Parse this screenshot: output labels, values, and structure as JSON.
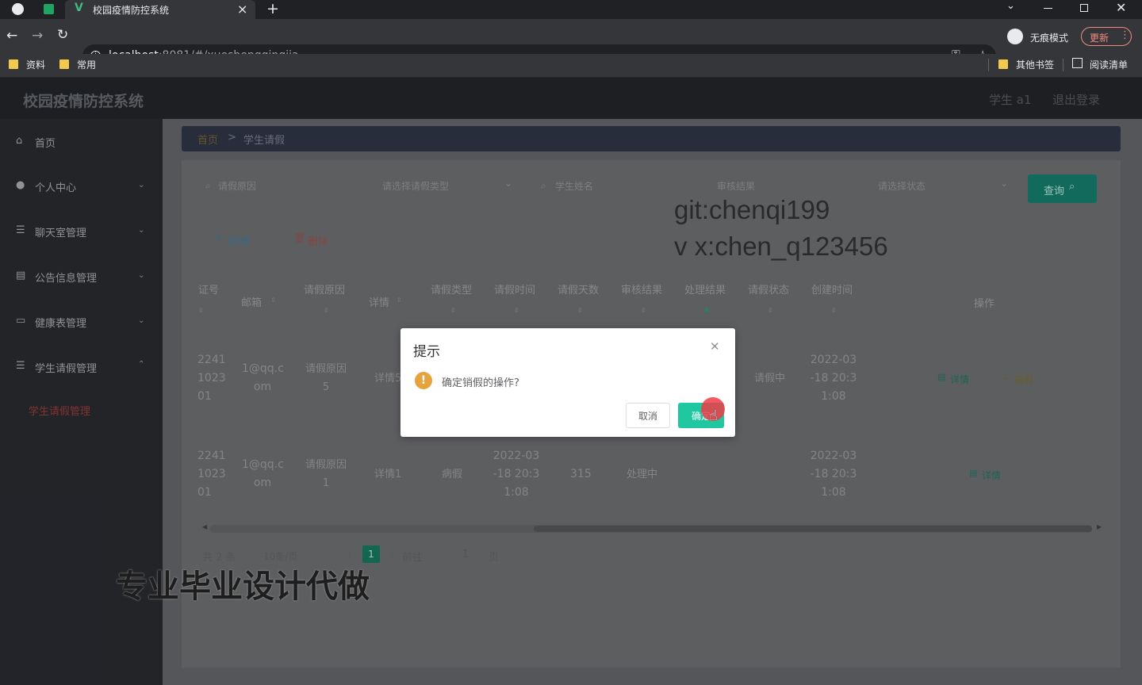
{
  "browser": {
    "tab_title": "校园疫情防控系统",
    "close_tab": "×",
    "new_tab": "+",
    "url_host": "localhost",
    "url_rest": ":8081/#/xueshengqingjia",
    "incognito_label": "无痕模式",
    "update_label": "更新",
    "bookmarks": [
      "资料",
      "常用"
    ],
    "other_bookmarks": "其他书签",
    "reading_list": "阅读清单"
  },
  "app": {
    "title": "校园疫情防控系统",
    "user": "学生 a1",
    "logout": "退出登录"
  },
  "sidebar": {
    "items": [
      {
        "label": "首页",
        "icon": "home-icon"
      },
      {
        "label": "个人中心",
        "icon": "user-icon"
      },
      {
        "label": "聊天室管理",
        "icon": "menu-icon"
      },
      {
        "label": "公告信息管理",
        "icon": "board-icon"
      },
      {
        "label": "健康表管理",
        "icon": "chat-icon"
      },
      {
        "label": "学生请假管理",
        "icon": "menu-icon"
      }
    ],
    "sub_active": "学生请假管理"
  },
  "breadcrumb": {
    "home": "首页",
    "sep": ">",
    "current": "学生请假"
  },
  "filters": {
    "reason": "请假原因",
    "type": "请选择请假类型",
    "student_name": "学生姓名",
    "result": "审核结果",
    "status": "请选择状态",
    "query": "查询"
  },
  "actions": {
    "add": "新增",
    "delete": "删除"
  },
  "table": {
    "columns": [
      "证号",
      "邮箱",
      "请假原因",
      "详情",
      "请假类型",
      "请假时间",
      "请假天数",
      "审核结果",
      "处理结果",
      "请假状态",
      "创建时间",
      "操作"
    ],
    "rows": [
      {
        "id_line1": "2241",
        "id_line2": "1023",
        "id_line3": "01",
        "email_line1": "1@qq.c",
        "email_line2": "om",
        "reason_line1": "请假原因",
        "reason_line2": "5",
        "detail": "详情5",
        "status": "请假中",
        "created_line1": "2022-03",
        "created_line2": "-18 20:3",
        "created_line3": "1:08",
        "op_detail": "详情",
        "op_cancel": "销假"
      },
      {
        "id_line1": "2241",
        "id_line2": "1023",
        "id_line3": "01",
        "email_line1": "1@qq.c",
        "email_line2": "om",
        "reason_line1": "请假原因",
        "reason_line2": "1",
        "detail": "详情1",
        "type": "病假",
        "time_line1": "2022-03",
        "time_line2": "-18 20:3",
        "time_line3": "1:08",
        "days": "315",
        "result": "处理中",
        "created_line1": "2022-03",
        "created_line2": "-18 20:3",
        "created_line3": "1:08",
        "op_detail": "详情"
      }
    ]
  },
  "pagination": {
    "total": "共 2 条",
    "page_size": "10条/页",
    "current": "1",
    "goto": "前往",
    "goto_value": "1",
    "page_suffix": "页"
  },
  "dialog": {
    "title": "提示",
    "message": "确定销假的操作?",
    "cancel": "取消",
    "confirm": "确定"
  },
  "watermark": {
    "line1": "git:chenqi199",
    "line2": "v x:chen_q123456",
    "caption": "专业毕业设计代做"
  },
  "colors": {
    "primary": "#1fc8a0",
    "warn": "#e6a23c",
    "danger": "#f56c6c",
    "query_btn": "#127060"
  }
}
